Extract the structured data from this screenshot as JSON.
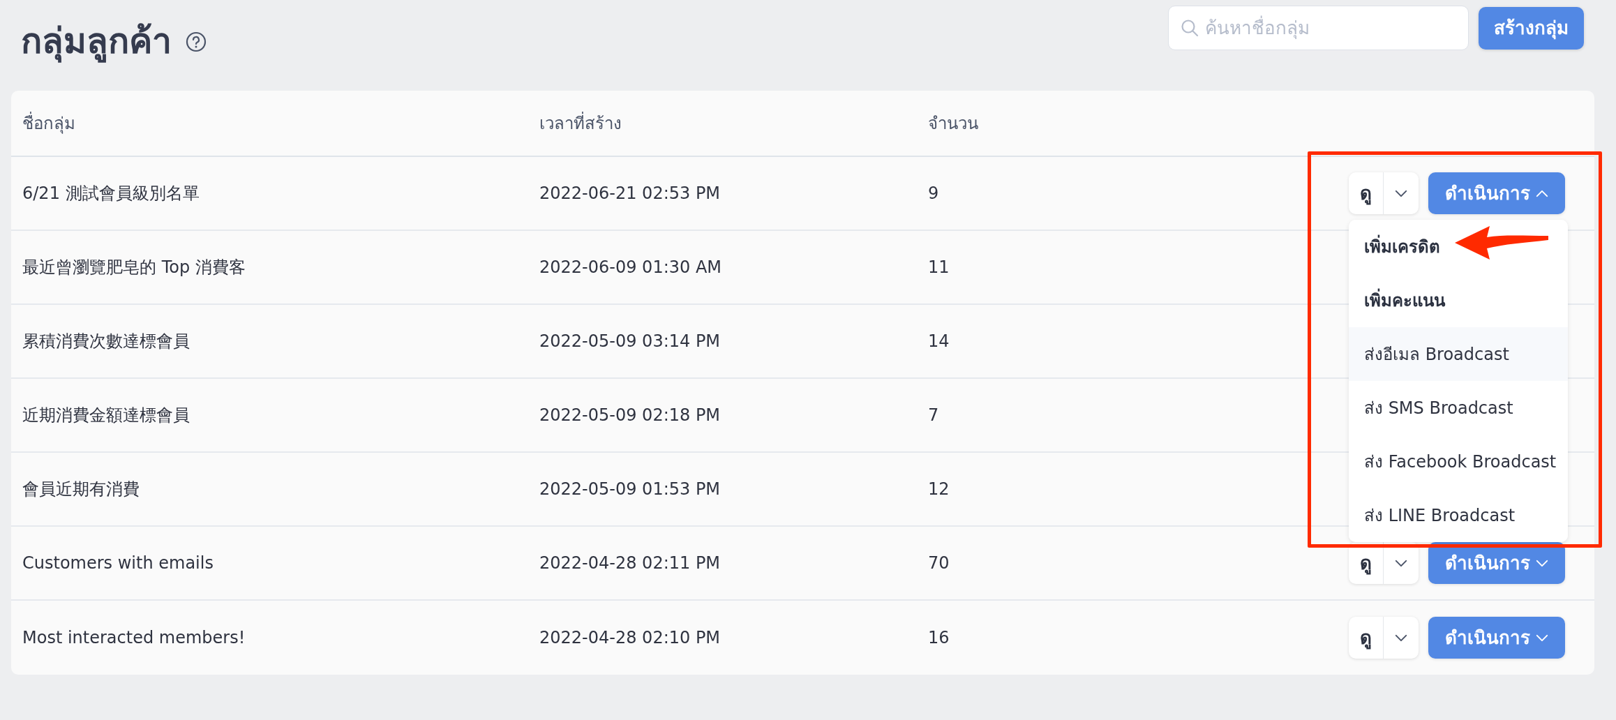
{
  "page": {
    "title": "กลุ่มลูกค้า"
  },
  "search": {
    "placeholder": "ค้นหาชื่อกลุ่ม"
  },
  "create_button": "สร้างกลุ่ม",
  "table": {
    "columns": [
      "ชื่อกลุ่ม",
      "เวลาที่สร้าง",
      "จำนวน"
    ],
    "rows": [
      {
        "name": "6/21 測試會員級別名單",
        "created": "2022-06-21 02:53 PM",
        "count": "9",
        "view_label": "ดู",
        "action_label": "ดำเนินการ",
        "expanded": true
      },
      {
        "name": "最近曾瀏覽肥皂的 Top 消費客",
        "created": "2022-06-09 01:30 AM",
        "count": "11"
      },
      {
        "name": "累積消費次數達標會員",
        "created": "2022-05-09 03:14 PM",
        "count": "14"
      },
      {
        "name": "近期消費金額達標會員",
        "created": "2022-05-09 02:18 PM",
        "count": "7"
      },
      {
        "name": "會員近期有消費",
        "created": "2022-05-09 01:53 PM",
        "count": "12"
      },
      {
        "name": "Customers with emails",
        "created": "2022-04-28 02:11 PM",
        "count": "70",
        "view_label": "ดู",
        "action_label": "ดำเนินการ",
        "expanded": false
      },
      {
        "name": "Most interacted members!",
        "created": "2022-04-28 02:10 PM",
        "count": "16",
        "view_label": "ดู",
        "action_label": "ดำเนินการ",
        "expanded": false
      }
    ]
  },
  "action_menu": {
    "items": [
      {
        "label": "เพิ่มเครดิต",
        "selected": false
      },
      {
        "label": "เพิ่มคะแนน",
        "selected": false
      },
      {
        "label": "ส่งอีเมล Broadcast",
        "selected": true
      },
      {
        "label": "ส่ง SMS Broadcast",
        "selected": false
      },
      {
        "label": "ส่ง Facebook Broadcast",
        "selected": false
      },
      {
        "label": "ส่ง LINE Broadcast",
        "selected": false
      }
    ]
  },
  "annotations": {
    "frame": true,
    "arrow": true
  }
}
